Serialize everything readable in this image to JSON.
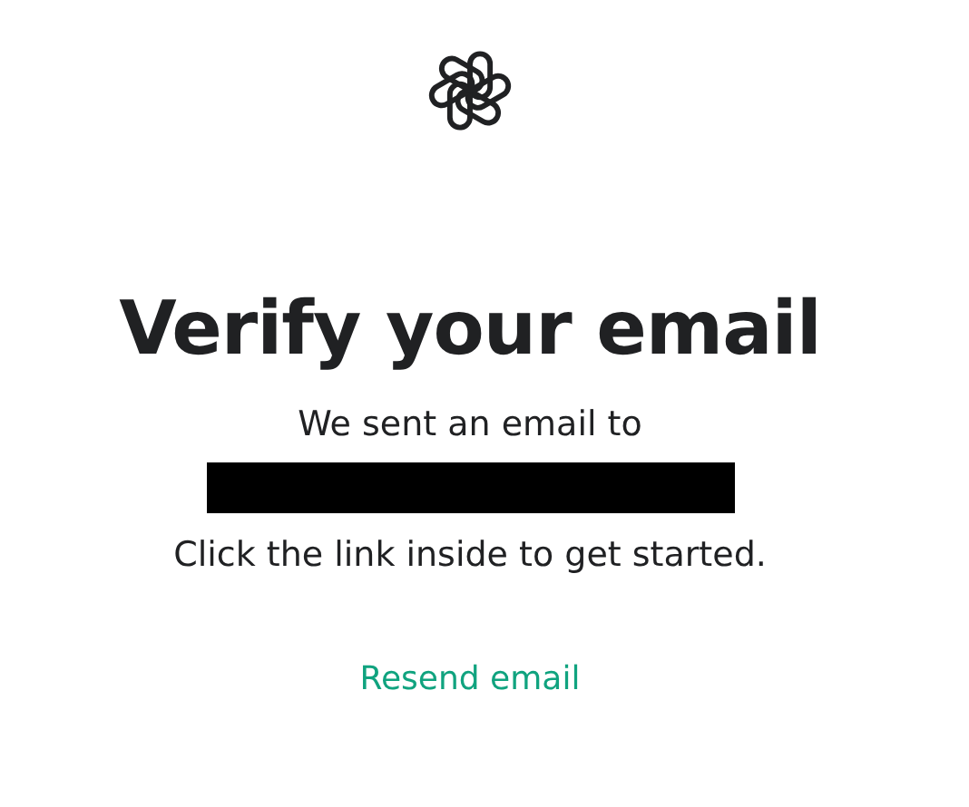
{
  "heading": "Verify your email",
  "message_lines": [
    "We sent an email to",
    "Click the link inside to get started."
  ],
  "email_redacted": true,
  "resend_link": "Resend email"
}
